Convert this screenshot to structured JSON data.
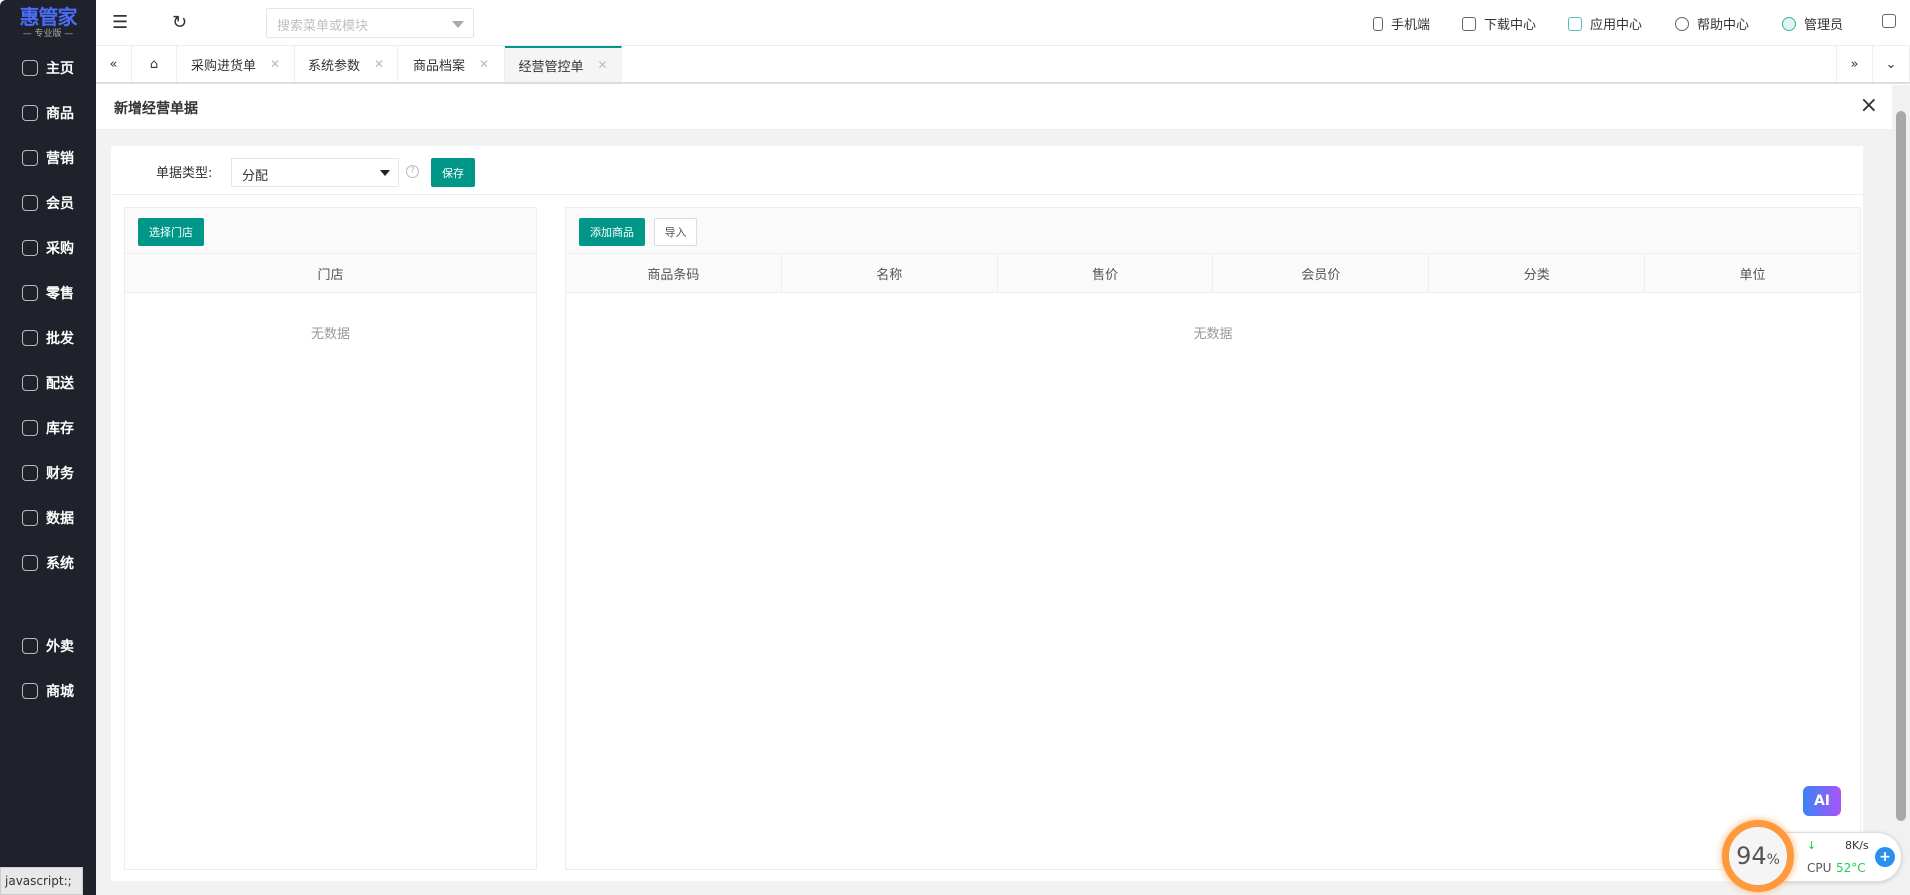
{
  "logo": {
    "title": "惠管家",
    "subtitle": "— 专业版 —"
  },
  "sidebar": {
    "items": [
      {
        "label": "主页",
        "icon": "home-icon"
      },
      {
        "label": "商品",
        "icon": "box-icon"
      },
      {
        "label": "营销",
        "icon": "chart-icon"
      },
      {
        "label": "会员",
        "icon": "heart-icon"
      },
      {
        "label": "采购",
        "icon": "cart-icon"
      },
      {
        "label": "零售",
        "icon": "bag-icon"
      },
      {
        "label": "批发",
        "icon": "building-icon"
      },
      {
        "label": "配送",
        "icon": "truck-icon"
      },
      {
        "label": "库存",
        "icon": "inventory-icon"
      },
      {
        "label": "财务",
        "icon": "finance-icon"
      },
      {
        "label": "数据",
        "icon": "data-icon"
      },
      {
        "label": "系统",
        "icon": "settings-icon"
      },
      {
        "label": "外卖",
        "icon": "bike-icon"
      },
      {
        "label": "商城",
        "icon": "store-icon"
      }
    ]
  },
  "header": {
    "search_placeholder": "搜索菜单或模块",
    "mobile": "手机端",
    "download": "下载中心",
    "apps": "应用中心",
    "help": "帮助中心",
    "user": "管理员"
  },
  "tabs": [
    {
      "label": "采购进货单"
    },
    {
      "label": "系统参数"
    },
    {
      "label": "商品档案"
    },
    {
      "label": "经营管控单"
    }
  ],
  "page": {
    "title": "新增经营单据",
    "type_label": "单据类型:",
    "type_value": "分配",
    "save": "保存"
  },
  "left_panel": {
    "button": "选择门店",
    "column": "门店",
    "empty": "无数据"
  },
  "right_panel": {
    "add": "添加商品",
    "import": "导入",
    "columns": [
      "商品条码",
      "名称",
      "售价",
      "会员价",
      "分类",
      "单位"
    ],
    "empty": "无数据"
  },
  "widgets": {
    "ai": "AI",
    "gauge": "94",
    "gauge_unit": "%",
    "net": "8K/s",
    "cpu_label": "CPU",
    "cpu_temp": "52°C"
  },
  "status_bar": "javascript:;"
}
